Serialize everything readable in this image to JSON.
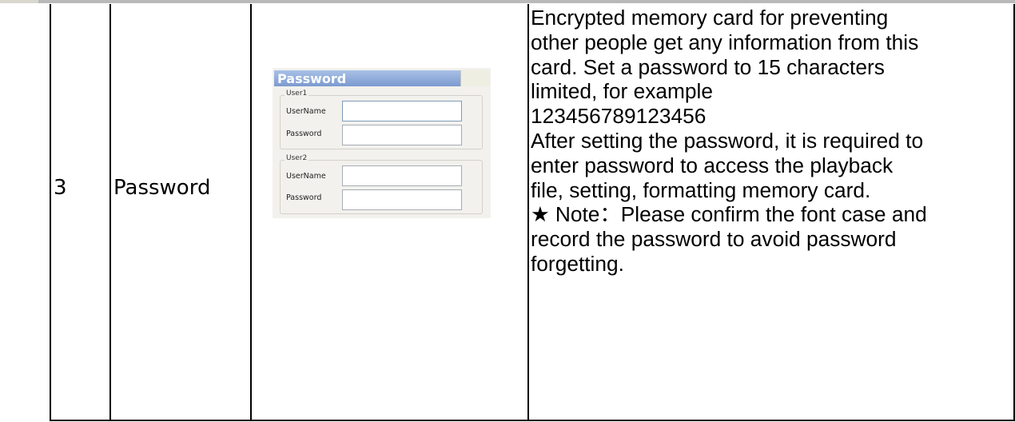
{
  "row": {
    "number": "3",
    "name": "Password",
    "description": [
      "Encrypted memory card for preventing",
      "other people get any information from this",
      "card. Set a password to 15 characters",
      "limited, for example",
      "123456789123456",
      "After setting the password, it is required to",
      "enter password to access the playback",
      "file, setting, formatting memory card.",
      "★ Note：Please confirm the font case and",
      "record the password to avoid password",
      "forgetting."
    ]
  },
  "screenshot": {
    "title": "Password",
    "groups": [
      {
        "legend": "User1",
        "fields": [
          {
            "label": "UserName",
            "value": ""
          },
          {
            "label": "Password",
            "value": ""
          }
        ]
      },
      {
        "legend": "User2",
        "fields": [
          {
            "label": "UserName",
            "value": ""
          },
          {
            "label": "Password",
            "value": ""
          }
        ]
      }
    ]
  },
  "colors": {
    "title_bar": "#7c9ad0",
    "panel_bg": "#f2f1ed",
    "border": "#000000"
  }
}
